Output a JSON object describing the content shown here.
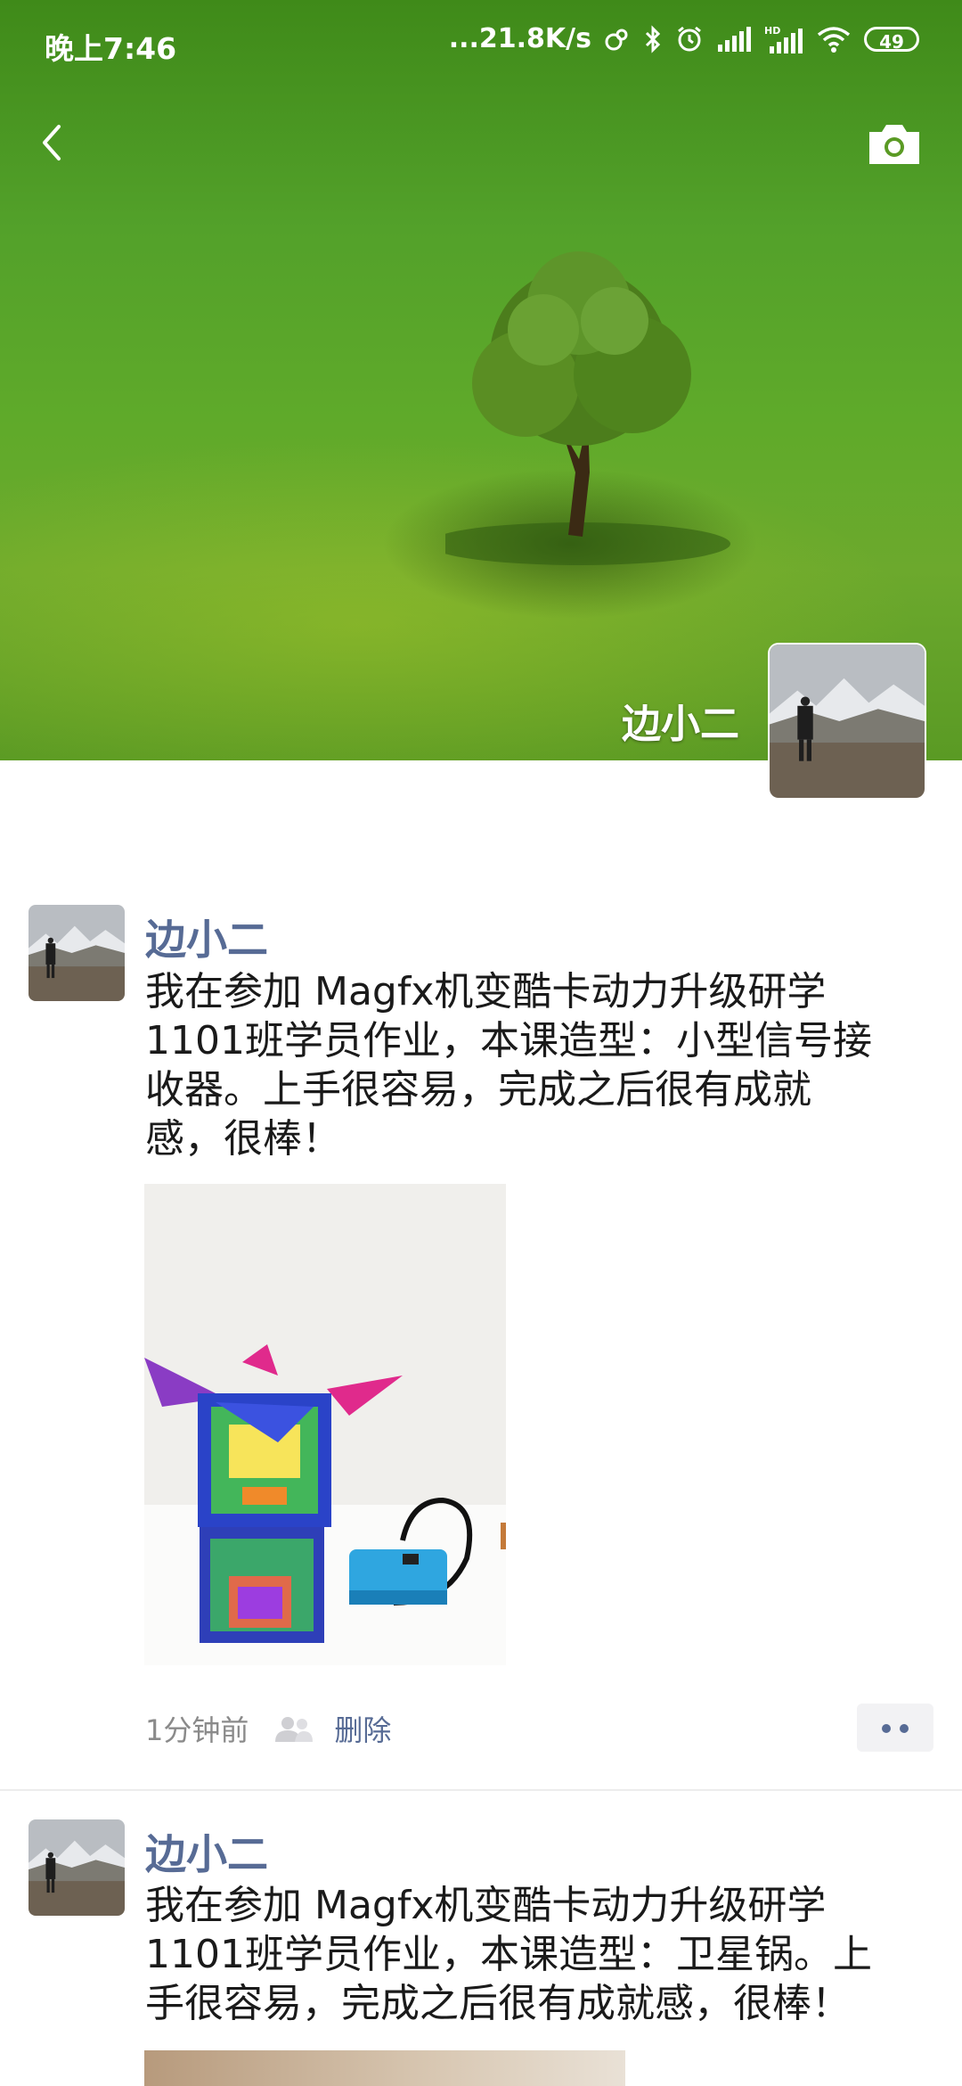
{
  "status_bar": {
    "time": "晚上7:46",
    "speed": "...21.8K/s",
    "battery": "49",
    "icons": [
      "link-icon",
      "bluetooth-icon",
      "alarm-icon",
      "signal-icon",
      "hd-signal-icon",
      "wifi-icon",
      "battery-icon"
    ]
  },
  "header": {
    "back_icon": "chevron-left-icon",
    "camera_icon": "camera-icon",
    "profile_name": "边小二"
  },
  "posts": [
    {
      "author": "边小二",
      "text": "我在参加 Magfx机变酷卡动力升级研学\n1101班学员作业，本课造型：小型信号接\n收器。上手很容易，完成之后很有成就\n感，很棒！",
      "time": "1分钟前",
      "delete_label": "删除",
      "privacy_icon": "people-icon",
      "more_icon": "more-dots-icon"
    },
    {
      "author": "边小二",
      "text": "我在参加 Magfx机变酷卡动力升级研学\n1101班学员作业，本课造型：卫星锅。上\n手很容易，完成之后很有成就感，很棒！"
    }
  ],
  "colors": {
    "name_link": "#576b95",
    "text": "#1a1a1a",
    "meta": "#8a8a8a",
    "grass": "#5faa2a"
  }
}
